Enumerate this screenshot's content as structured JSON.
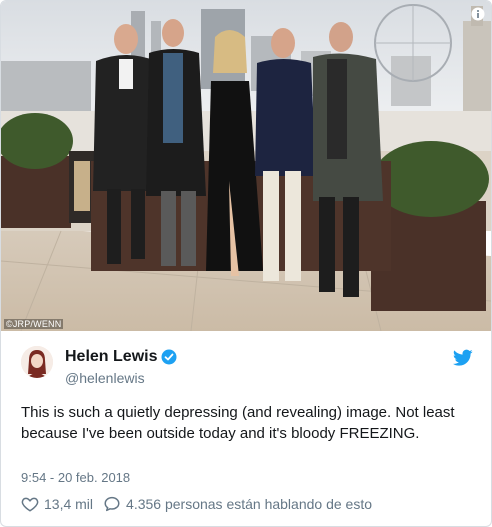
{
  "photo": {
    "credit": "©JRP/WENN"
  },
  "tweet": {
    "name": "Helen Lewis",
    "handle": "@helenlewis",
    "text": "This is such a quietly depressing (and revealing) image. Not least because I've been outside today and it's bloody FREEZING.",
    "timestamp": "9:54 - 20 feb. 2018",
    "likes": "13,4 mil",
    "replies_label": "4.356 personas están hablando de esto"
  },
  "colors": {
    "twitter_blue": "#1da1f2",
    "text_primary": "#14171a",
    "text_secondary": "#657786"
  },
  "icons": [
    "info-icon",
    "verified-badge-icon",
    "twitter-bird-icon",
    "heart-icon",
    "comment-icon"
  ]
}
